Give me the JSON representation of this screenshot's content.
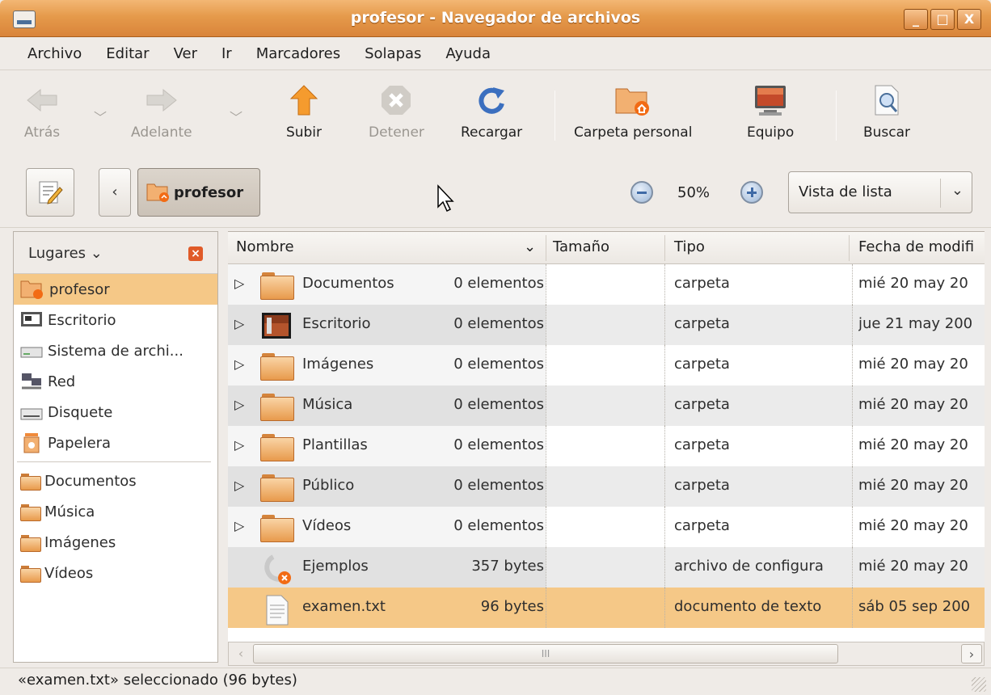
{
  "window": {
    "title": "profesor - Navegador de archivos",
    "controls": [
      "_",
      "□",
      "X"
    ]
  },
  "menu": [
    "Archivo",
    "Editar",
    "Ver",
    "Ir",
    "Marcadores",
    "Solapas",
    "Ayuda"
  ],
  "toolbar": {
    "back": "Atrás",
    "forward": "Adelante",
    "up": "Subir",
    "stop": "Detener",
    "reload": "Recargar",
    "home": "Carpeta personal",
    "computer": "Equipo",
    "search": "Buscar"
  },
  "location": {
    "back_arrow": "‹",
    "crumb": "profesor",
    "zoom": "50%",
    "view": "Vista de lista",
    "view_arrow": "⌄"
  },
  "sidebar": {
    "header": "Lugares",
    "places": [
      {
        "label": "profesor",
        "icon": "home-folder-icon",
        "selected": true
      },
      {
        "label": "Escritorio",
        "icon": "desktop-icon"
      },
      {
        "label": "Sistema de archi...",
        "icon": "filesystem-icon"
      },
      {
        "label": "Red",
        "icon": "network-icon"
      },
      {
        "label": "Disquete",
        "icon": "floppy-icon"
      },
      {
        "label": "Papelera",
        "icon": "trash-icon"
      }
    ],
    "bookmarks": [
      {
        "label": "Documentos",
        "icon": "folder-icon"
      },
      {
        "label": "Música",
        "icon": "folder-icon"
      },
      {
        "label": "Imágenes",
        "icon": "folder-icon"
      },
      {
        "label": "Vídeos",
        "icon": "folder-icon"
      }
    ]
  },
  "columns": {
    "name": "Nombre",
    "size": "Tamaño",
    "type": "Tipo",
    "date": "Fecha de modifi"
  },
  "files": [
    {
      "name": "Documentos",
      "size": "0 elementos",
      "type": "carpeta",
      "date": "mié 20 may 20",
      "icon": "folder-icon",
      "expander": true
    },
    {
      "name": "Escritorio",
      "size": "0 elementos",
      "type": "carpeta",
      "date": "jue 21 may 200",
      "icon": "desktop-folder-icon",
      "expander": true
    },
    {
      "name": "Imágenes",
      "size": "0 elementos",
      "type": "carpeta",
      "date": "mié 20 may 20",
      "icon": "folder-icon",
      "expander": true
    },
    {
      "name": "Música",
      "size": "0 elementos",
      "type": "carpeta",
      "date": "mié 20 may 20",
      "icon": "folder-icon",
      "expander": true
    },
    {
      "name": "Plantillas",
      "size": "0 elementos",
      "type": "carpeta",
      "date": "mié 20 may 20",
      "icon": "folder-icon",
      "expander": true
    },
    {
      "name": "Público",
      "size": "0 elementos",
      "type": "carpeta",
      "date": "mié 20 may 20",
      "icon": "folder-icon",
      "expander": true
    },
    {
      "name": "Vídeos",
      "size": "0 elementos",
      "type": "carpeta",
      "date": "mié 20 may 20",
      "icon": "folder-icon",
      "expander": true
    },
    {
      "name": "Ejemplos",
      "size": "357 bytes",
      "type": "archivo de configura",
      "date": "mié 20 may 20",
      "icon": "broken-link-icon",
      "expander": false
    },
    {
      "name": "examen.txt",
      "size": "96 bytes",
      "type": "documento de texto",
      "date": "sáb 05 sep 200",
      "icon": "text-file-icon",
      "expander": false,
      "selected": true
    }
  ],
  "scrollbar": {
    "left": "‹",
    "right": "›",
    "grip": "III"
  },
  "status": "«examen.txt» seleccionado (96 bytes)",
  "colors": {
    "accent": "#e59a4b",
    "selection": "#f5c887"
  }
}
